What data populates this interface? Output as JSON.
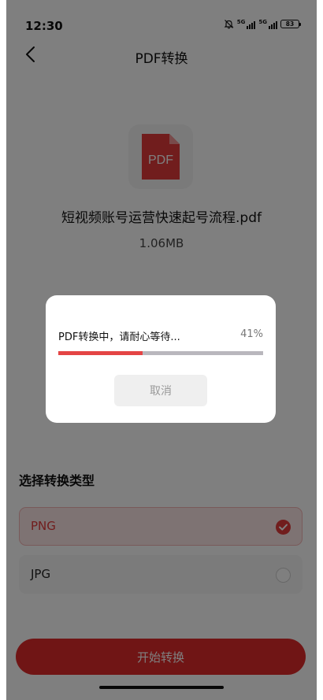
{
  "status_bar": {
    "time": "12:30",
    "signal1_label": "5G",
    "signal2_label": "5G",
    "battery": "83"
  },
  "header": {
    "title": "PDF转换",
    "back_icon": "chevron-left-icon"
  },
  "file": {
    "icon_label": "PDF",
    "name": "短视频账号运营快速起号流程.pdf",
    "size": "1.06MB"
  },
  "conversion": {
    "section_title": "选择转换类型",
    "options": [
      {
        "label": "PNG",
        "selected": true
      },
      {
        "label": "JPG",
        "selected": false
      }
    ],
    "start_label": "开始转换"
  },
  "dialog": {
    "progress_text": "PDF转换中，请耐心等待...",
    "progress_percent_text": "41%",
    "progress_value": 0.41,
    "cancel_label": "取消"
  },
  "colors": {
    "accent": "#e02b2b",
    "progress_fill": "#e44444",
    "progress_track": "#b9b7bd"
  }
}
